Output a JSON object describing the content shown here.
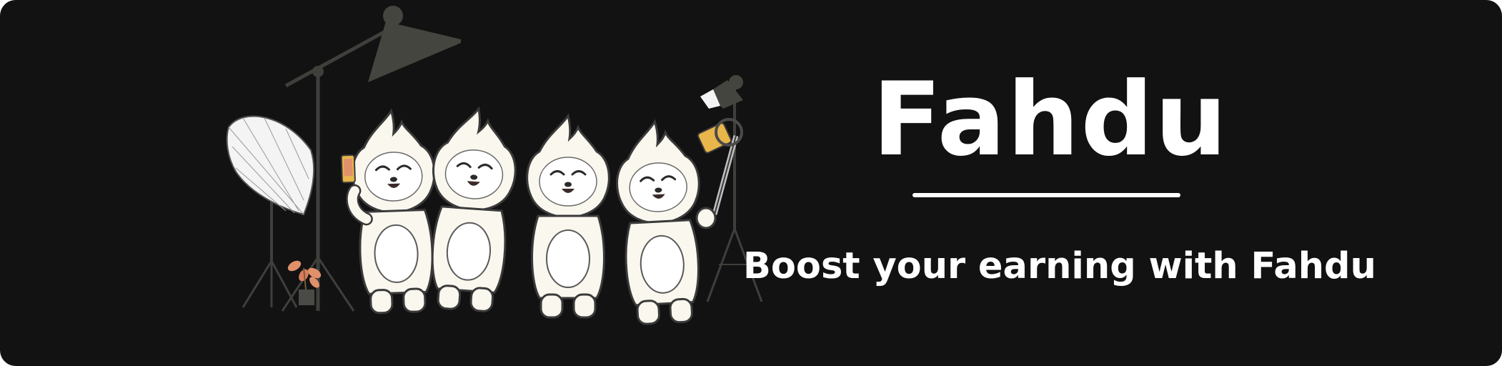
{
  "banner": {
    "brand_name": "Fahdu",
    "tagline": "Boost your earning with Fahdu"
  },
  "illustration": {
    "mascot_count": 4,
    "props": [
      "umbrella-light-icon",
      "boom-light-icon",
      "tripod-icon",
      "ring-light-icon",
      "selfie-stick-icon",
      "phone-icon",
      "potted-plant-icon"
    ]
  },
  "colors": {
    "background": "#121212",
    "text": "#ffffff",
    "mascot_fill": "#faf7ee",
    "outline": "#3a3a3a",
    "equipment": "#3f3f3c",
    "accent_yellow": "#e8b64a",
    "accent_orange": "#e0906a"
  }
}
